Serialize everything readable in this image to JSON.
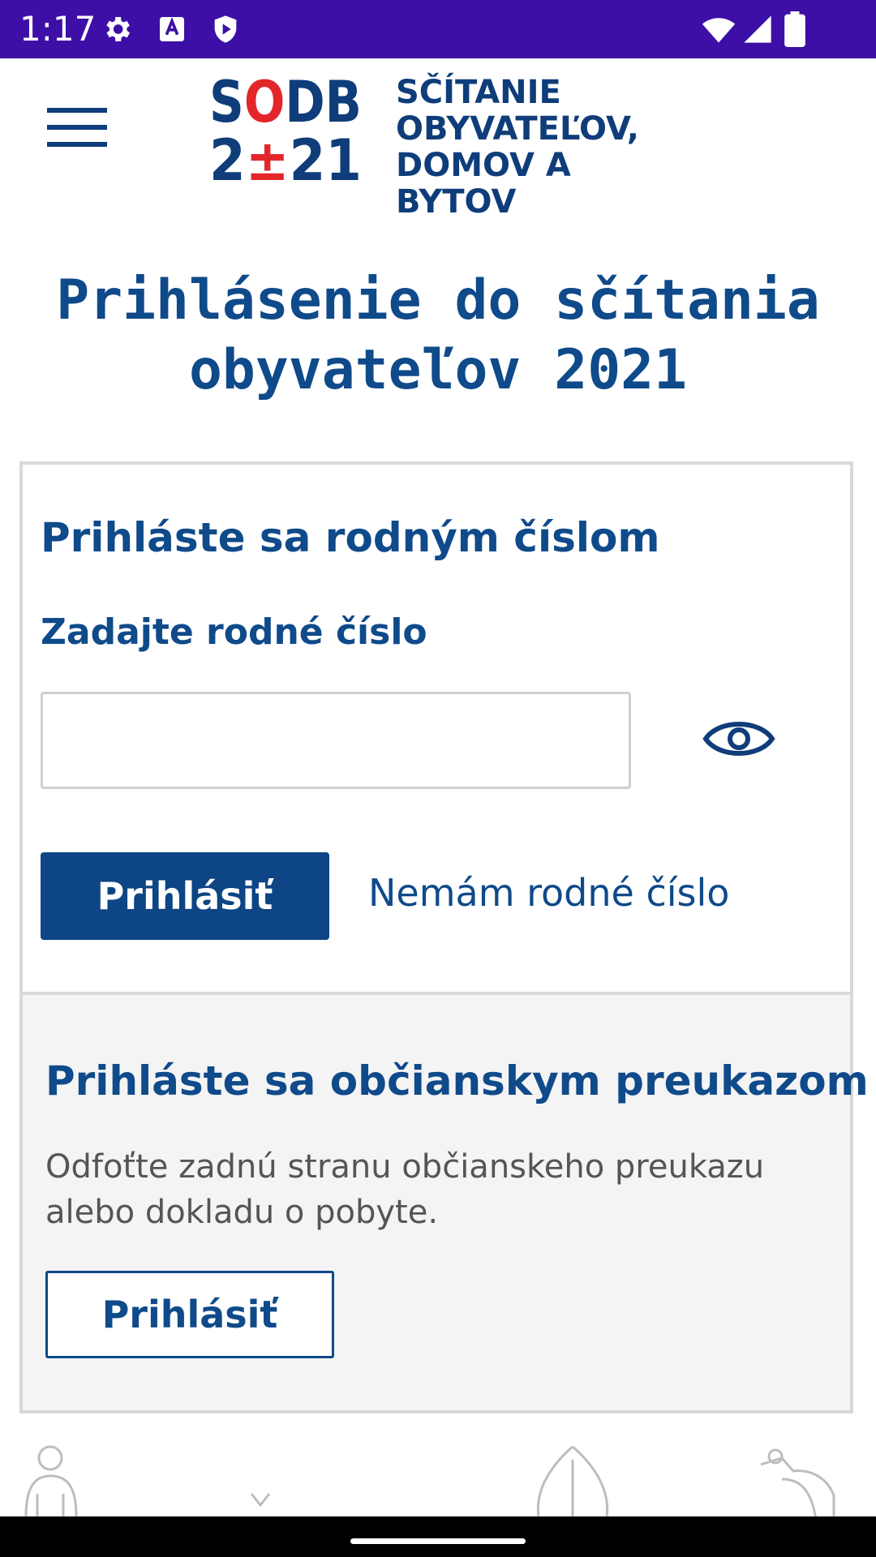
{
  "status_bar": {
    "time": "1:17",
    "icons": [
      "gear-icon",
      "text-a-icon",
      "shield-play-icon",
      "wifi-icon",
      "signal-icon",
      "battery-icon"
    ]
  },
  "header": {
    "menu_icon": "hamburger-menu-icon",
    "logo_numbers_top": "SODB",
    "logo_numbers_bottom": "2±21",
    "logo_text": "SČÍTANIE\nOBYVATEĽOV,\nDOMOV A BYTOV"
  },
  "page": {
    "title": "Prihlásenie do sčítania obyvateľov 2021"
  },
  "rc_login": {
    "heading": "Prihláste sa rodným číslom",
    "field_label": "Zadajte rodné číslo",
    "field_value": "",
    "field_placeholder": "",
    "toggle_icon": "eye-icon",
    "submit_label": "Prihlásiť",
    "no_rc_link": "Nemám rodné číslo"
  },
  "id_login": {
    "heading": "Prihláste sa občianskym preukazom",
    "description": "Odfoťte zadnú stranu občianskeho preukazu alebo dokladu o pobyte.",
    "submit_label": "Prihlásiť"
  },
  "colors": {
    "status_bar": "#3d0fa6",
    "brand_blue": "#0f4a8a",
    "primary_button": "#0d4585",
    "logo_red": "#e3262a"
  },
  "decorations": [
    "person-illustration",
    "chevron-illustration",
    "leaf-illustration",
    "figure-illustration"
  ]
}
